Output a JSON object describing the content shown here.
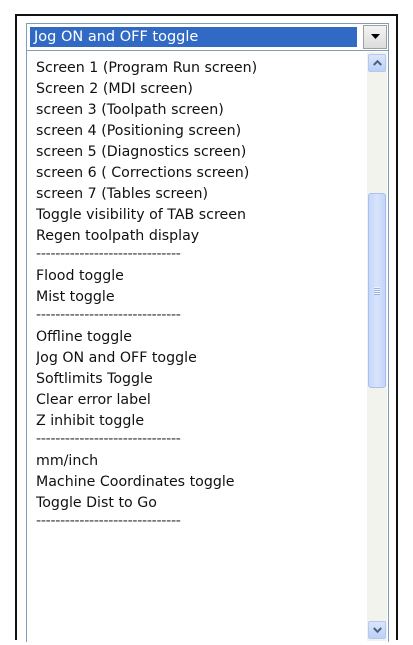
{
  "combo": {
    "selected": "Jog ON and OFF toggle",
    "dropdown_icon": "chevron-down-icon"
  },
  "list": {
    "items": [
      "Screen 1 (Program Run screen)",
      "Screen 2 (MDI screen)",
      "screen 3 (Toolpath screen)",
      "screen 4 (Positioning screen)",
      "screen 5 (Diagnostics screen)",
      "screen 6 ( Corrections screen)",
      "screen 7 (Tables screen)",
      "Toggle visibility of TAB screen",
      "Regen toolpath display",
      "------------------------------",
      "Flood toggle",
      "Mist toggle",
      "------------------------------",
      "Offline toggle",
      "Jog ON and OFF toggle",
      "Softlimits Toggle",
      "Clear error label",
      "Z inhibit toggle",
      "------------------------------",
      "mm/inch",
      "Machine Coordinates toggle",
      "Toggle Dist to Go",
      "------------------------------"
    ]
  },
  "scrollbar": {
    "up_icon": "chevron-up-icon",
    "down_icon": "chevron-down-icon",
    "thumb_icon": "grip-icon",
    "colors": {
      "arrow": "#4d6185",
      "thumb": "#c7d7fa"
    }
  }
}
